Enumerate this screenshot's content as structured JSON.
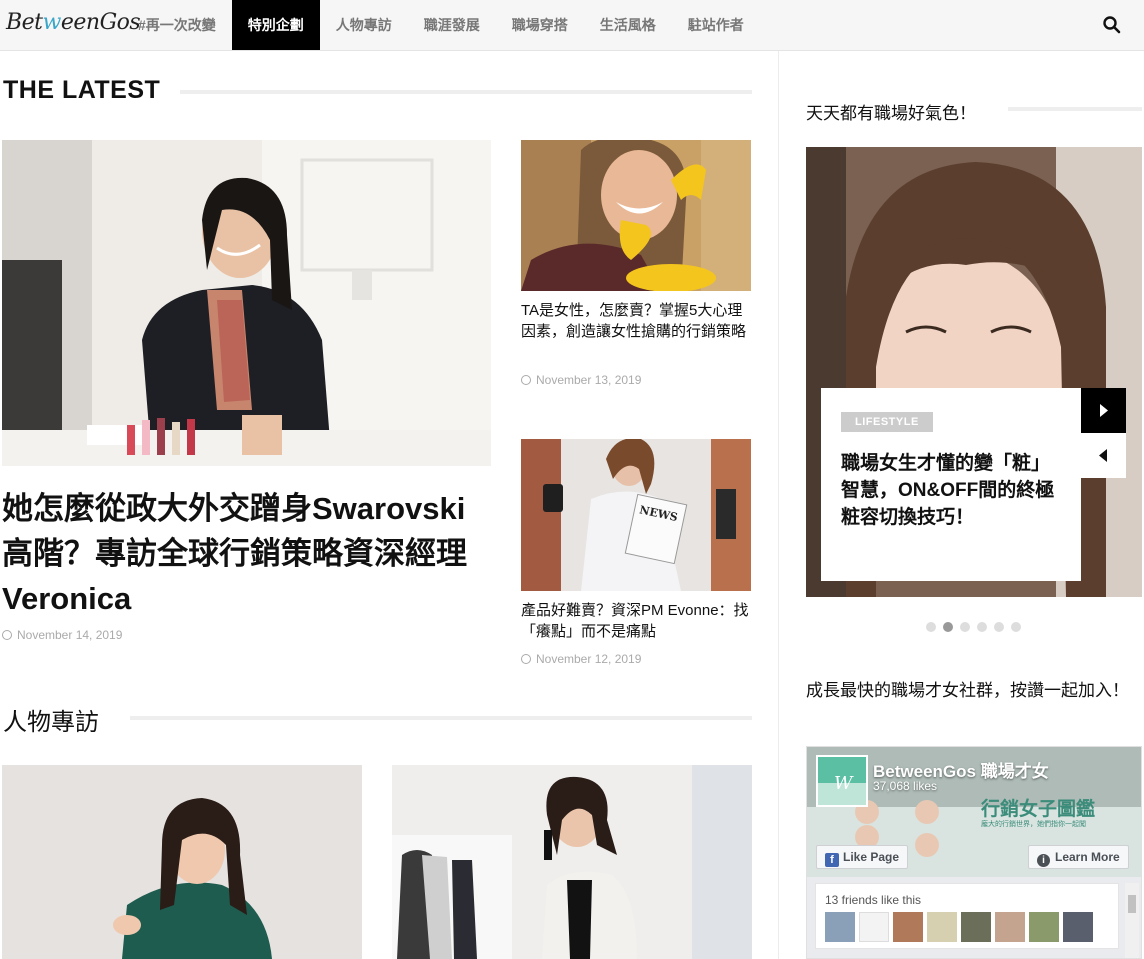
{
  "site": {
    "logo_prefix": "Bet",
    "logo_mid": "w",
    "logo_suffix": "eenGos"
  },
  "nav": {
    "items": [
      {
        "label": "#再一次改變",
        "active": false
      },
      {
        "label": "特別企劃",
        "active": true
      },
      {
        "label": "人物專訪",
        "active": false
      },
      {
        "label": "職涯發展",
        "active": false
      },
      {
        "label": "職場穿搭",
        "active": false
      },
      {
        "label": "生活風格",
        "active": false
      },
      {
        "label": "駐站作者",
        "active": false
      }
    ],
    "search_icon": "search-icon"
  },
  "latest": {
    "section_title": "THE LATEST",
    "featured": {
      "title": "她怎麼從政大外交蹭身Swarovski高階？專訪全球行銷策略資深經理Veronica",
      "date": "November 14, 2019"
    },
    "side_articles": [
      {
        "title": "TA是女性，怎麼賣？掌握5大心理因素，創造讓女性搶購的行銷策略",
        "date": "November 13, 2019"
      },
      {
        "title": "產品好難賣？資深PM Evonne：找「癢點」而不是痛點",
        "date": "November 12, 2019"
      }
    ]
  },
  "interviews": {
    "section_title": "人物專訪"
  },
  "sidebar": {
    "slider_title": "天天都有職場好氣色！",
    "slide": {
      "badge": "LIFESTYLE",
      "title": "職場女生才懂的變「粧」智慧，ON&OFF間的終極粧容切換技巧！"
    },
    "slider_dots": 6,
    "slider_active_dot": 1,
    "fb_title": "成長最快的職場才女社群，按讚一起加入！",
    "fb": {
      "page_name": "BetweenGos 職場才女",
      "likes": "37,068 likes",
      "like_button": "Like Page",
      "learn_more": "Learn More",
      "cover_text": "行銷女子圖鑑",
      "cover_sub": "龐大的行銷世界，她們指你一起闖",
      "friends_text": "13 friends like this"
    }
  },
  "colors": {
    "accent": "#000000",
    "nav_bg": "#f6f6f6",
    "muted": "#aaaaaa",
    "fb_blue": "#4267b2"
  }
}
